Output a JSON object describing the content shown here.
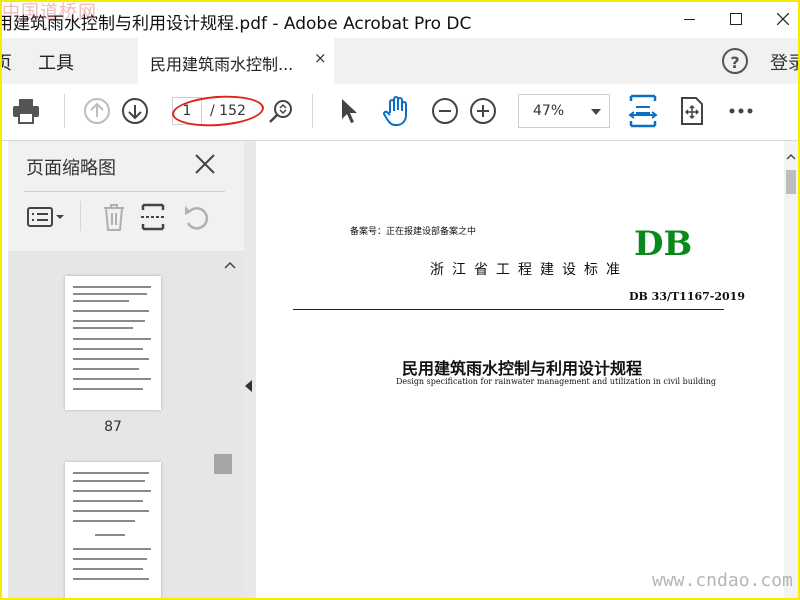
{
  "watermark_top": "中国道桥网",
  "watermark_bottom": "www.cndao.com",
  "window": {
    "title": "用建筑雨水控制与利用设计规程.pdf - Adobe Acrobat Pro DC"
  },
  "tabs": {
    "home_partial": "页",
    "tools": "工具",
    "document": "民用建筑雨水控制...",
    "close": "×"
  },
  "account": {
    "help": "?",
    "login": "登录"
  },
  "toolbar": {
    "page_current": "1",
    "page_total": "/ 152",
    "zoom": "47%"
  },
  "panel": {
    "title": "页面缩略图",
    "thumbnails": [
      {
        "label": "87"
      },
      {
        "label": ""
      }
    ]
  },
  "page": {
    "filing": "备案号：正在报建设部备案之中",
    "logo": "DB",
    "standard": "浙江省工程建设标准",
    "code": "DB 33/T1167-2019",
    "title": "民用建筑雨水控制与利用设计规程",
    "subtitle": "Design specification for rainwater management and utilization in civil building"
  },
  "colors": {
    "accent": "#0b6fc4",
    "db_green": "#0a8a1a",
    "annotation_red": "#e2231a"
  }
}
